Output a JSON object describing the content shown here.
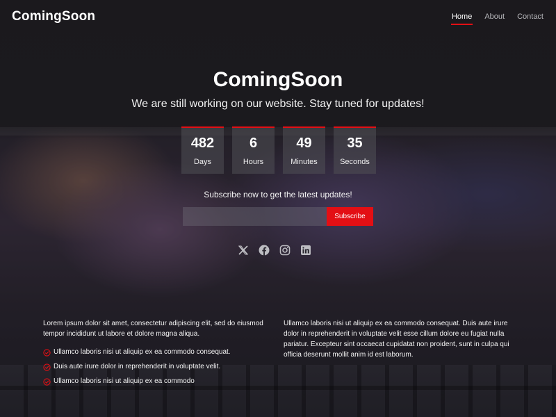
{
  "nav": {
    "logo": "ComingSoon",
    "links": [
      {
        "label": "Home",
        "active": true
      },
      {
        "label": "About",
        "active": false
      },
      {
        "label": "Contact",
        "active": false
      }
    ]
  },
  "hero": {
    "title": "ComingSoon",
    "subtitle": "We are still working on our website. Stay tuned for updates!"
  },
  "countdown": [
    {
      "value": "482",
      "label": "Days"
    },
    {
      "value": "6",
      "label": "Hours"
    },
    {
      "value": "49",
      "label": "Minutes"
    },
    {
      "value": "35",
      "label": "Seconds"
    }
  ],
  "subscribe": {
    "prompt": "Subscribe now to get the latest updates!",
    "email_value": "",
    "button_label": "Subscribe"
  },
  "social": [
    "x-icon",
    "facebook-icon",
    "instagram-icon",
    "linkedin-icon"
  ],
  "left_column": {
    "paragraph": "Lorem ipsum dolor sit amet, consectetur adipiscing elit, sed do eiusmod tempor incididunt ut labore et dolore magna aliqua.",
    "items": [
      "Ullamco laboris nisi ut aliquip ex ea commodo consequat.",
      "Duis aute irure dolor in reprehenderit in voluptate velit.",
      "Ullamco laboris nisi ut aliquip ex ea commodo"
    ]
  },
  "right_column": {
    "paragraph": "Ullamco laboris nisi ut aliquip ex ea commodo consequat. Duis aute irure dolor in reprehenderit in voluptate velit esse cillum dolore eu fugiat nulla pariatur. Excepteur sint occaecat cupidatat non proident, sunt in culpa qui officia deserunt mollit anim id est laborum."
  },
  "colors": {
    "accent": "#e30f14",
    "background": "#1f1e21",
    "text": "#ffffff",
    "nav_inactive": "#b9b9bd"
  }
}
